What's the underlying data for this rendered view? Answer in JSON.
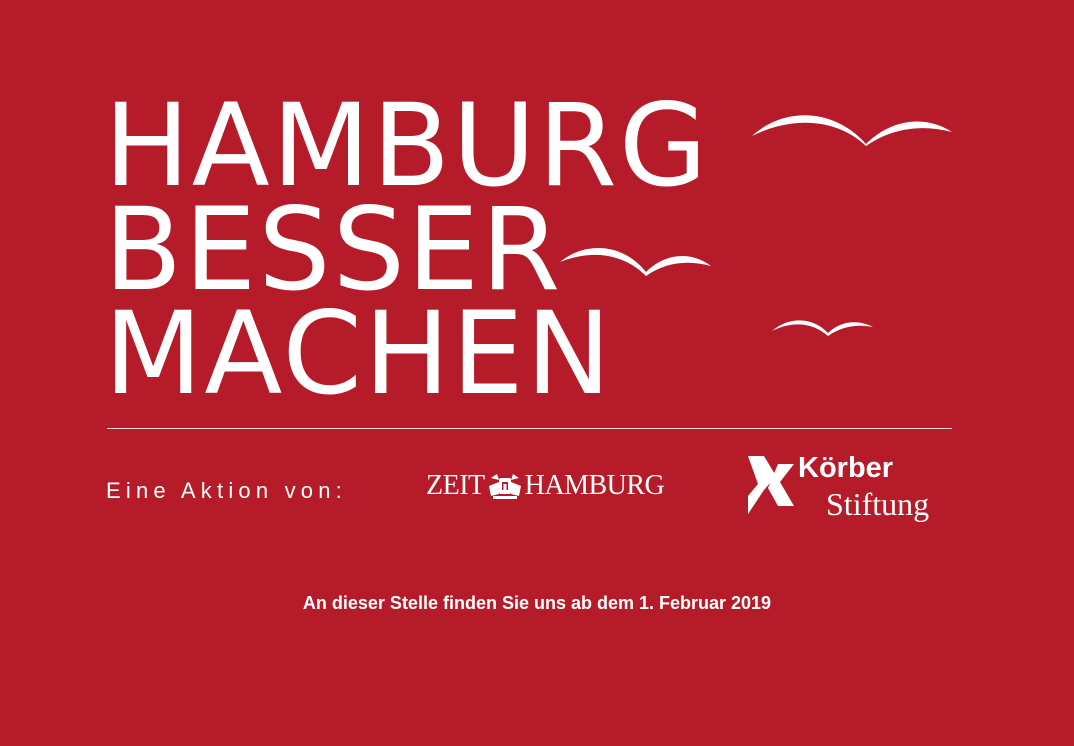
{
  "headline": {
    "line1": "HAMBURG",
    "line2": "BESSER",
    "line3": "MACHEN"
  },
  "byline": "Eine Aktion von:",
  "partners": {
    "zeit": {
      "left": "ZEIT",
      "right": "HAMBURG"
    },
    "koerber": {
      "name": "Körber",
      "sub": "Stiftung"
    }
  },
  "notice": "An dieser Stelle finden Sie uns ab dem 1. Februar 2019",
  "colors": {
    "background": "#b51b29",
    "foreground": "#ffffff"
  },
  "icons": {
    "birds": [
      "seagull-icon",
      "seagull-icon",
      "seagull-icon"
    ],
    "zeit_seal": "coat-of-arms-icon",
    "koerber_mark": "koerber-x-icon"
  }
}
